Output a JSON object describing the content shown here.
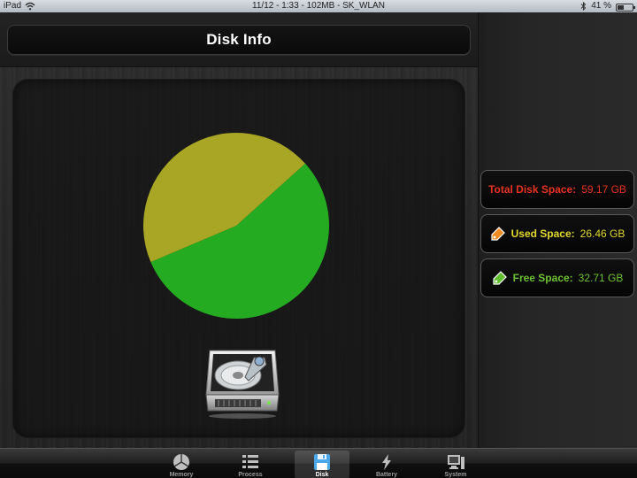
{
  "status_bar": {
    "device": "iPad",
    "center_text": "11/12 - 1:33 - 102MB - SK_WLAN",
    "battery": "41 %",
    "battery_level": 0.41
  },
  "header": {
    "title": "Disk Info"
  },
  "chart_data": {
    "type": "pie",
    "title": "",
    "slices": [
      {
        "name": "Free Space",
        "value": 32.71,
        "color": "#25ab22"
      },
      {
        "name": "Used Space",
        "value": 26.46,
        "color": "#a9a625"
      }
    ],
    "total": 59.17,
    "unit": "GB"
  },
  "info": {
    "total": {
      "label": "Total Disk Space:",
      "value": "59.17 GB",
      "color": "#e8321e"
    },
    "used": {
      "label": "Used Space:",
      "value": "26.46 GB",
      "color": "#e2d92e"
    },
    "free": {
      "label": "Free Space:",
      "value": "32.71 GB",
      "color": "#6dc232"
    }
  },
  "tabs": [
    {
      "label": "Memory",
      "icon": "pie-icon",
      "active": false
    },
    {
      "label": "Process",
      "icon": "list-icon",
      "active": false
    },
    {
      "label": "Disk",
      "icon": "floppy-disk-icon",
      "active": true
    },
    {
      "label": "Battery",
      "icon": "lightning-icon",
      "active": false
    },
    {
      "label": "System",
      "icon": "computer-icon",
      "active": false
    }
  ]
}
